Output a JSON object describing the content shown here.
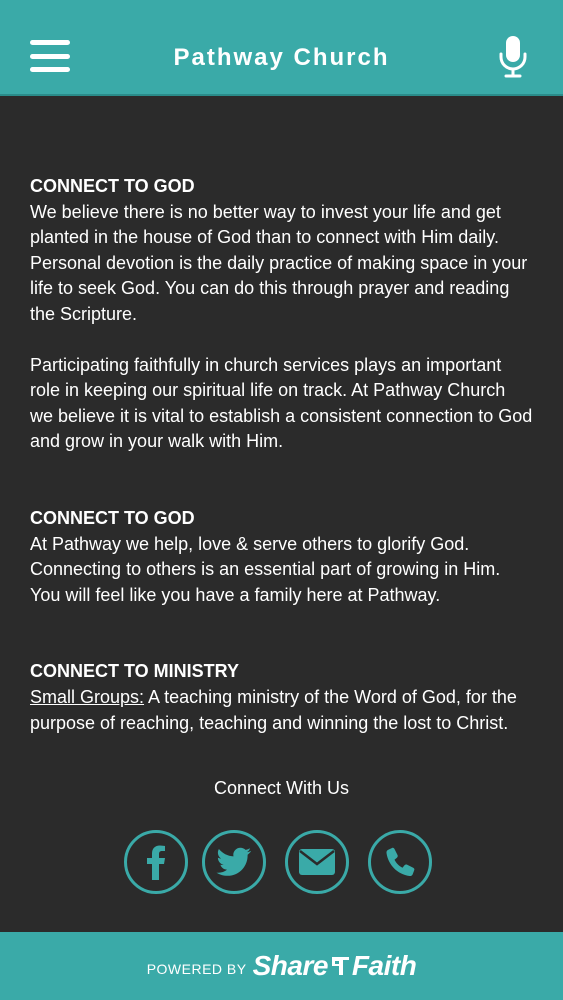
{
  "header": {
    "title": "Pathway Church",
    "menu_icon": "hamburger-menu-icon",
    "mic_icon": "microphone-icon"
  },
  "sections": [
    {
      "heading": "CONNECT TO GOD",
      "paragraphs": [
        "We believe there is no better way to invest your life and get planted in the house of God than to connect with Him daily. Personal devotion is the daily practice of making space in your life to seek God. You can do this through prayer and reading the Scripture.",
        "Participating faithfully in church services plays an important role in keeping our spiritual life on track. At Pathway Church we believe it is vital to establish a consistent connection to God and grow in your walk with Him."
      ]
    },
    {
      "heading": "CONNECT TO GOD",
      "paragraphs": [
        "At Pathway we help, love & serve others to glorify God. Connecting to others is an essential part of growing in Him. You will feel like you have a family here at Pathway."
      ]
    },
    {
      "heading": "CONNECT TO MINISTRY",
      "link": "Small Groups:",
      "paragraphs": [
        " A teaching ministry of the Word of God, for the purpose of reaching, teaching and winning the lost to Christ."
      ]
    }
  ],
  "connect": {
    "label": "Connect With Us",
    "icons": [
      "facebook-icon",
      "twitter-icon",
      "email-icon",
      "phone-icon"
    ]
  },
  "footer": {
    "powered_by": "POWERED BY",
    "brand_left": "Share",
    "brand_right": "Faith"
  },
  "colors": {
    "accent": "#3aaaa8",
    "background": "#2b2b2b",
    "text": "#ffffff"
  }
}
